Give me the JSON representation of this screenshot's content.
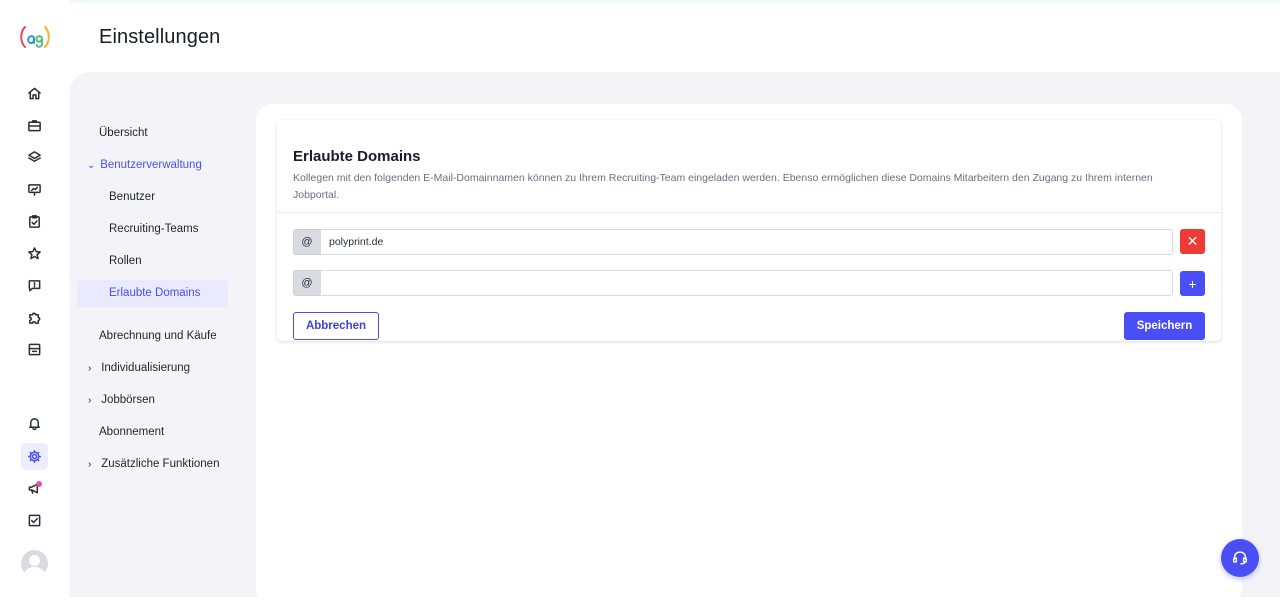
{
  "header": {
    "title": "Einstellungen"
  },
  "rail": {
    "items": [
      {
        "icon": "home-icon"
      },
      {
        "icon": "briefcase-icon"
      },
      {
        "icon": "layers-icon"
      },
      {
        "icon": "presentation-chart-icon"
      },
      {
        "icon": "clipboard-check-icon"
      },
      {
        "icon": "star-icon"
      },
      {
        "icon": "chat-exclamation-icon"
      },
      {
        "icon": "puzzle-icon"
      },
      {
        "icon": "archive-icon"
      }
    ],
    "bottom_items": [
      {
        "icon": "bell-icon"
      },
      {
        "icon": "gear-icon",
        "active": true
      },
      {
        "icon": "megaphone-icon",
        "has_notification": true
      },
      {
        "icon": "checkbox-icon"
      }
    ],
    "accent_color": "#4a4ff5"
  },
  "subnav": {
    "items": [
      {
        "label": "Übersicht"
      },
      {
        "label": "Benutzerverwaltung",
        "expanded": true
      },
      {
        "label": "Benutzer"
      },
      {
        "label": "Recruiting-Teams"
      },
      {
        "label": "Rollen"
      },
      {
        "label": "Erlaubte Domains",
        "selected": true
      },
      {
        "label": "Abrechnung und Käufe"
      },
      {
        "label": "Individualisierung",
        "collapsed": true
      },
      {
        "label": "Jobbörsen",
        "collapsed": true
      },
      {
        "label": "Abonnement"
      },
      {
        "label": "Zusätzliche Funktionen",
        "collapsed": true
      }
    ]
  },
  "card": {
    "title": "Erlaubte Domains",
    "description": "Kollegen mit den folgenden E-Mail-Domainnamen können zu Ihrem Recruiting-Team eingeladen werden. Ebenso ermöglichen diese Domains Mitarbeitern den Zugang zu Ihrem internen Jobportal.",
    "prefix": "@",
    "domains": [
      {
        "value": "polyprint.de",
        "action": "remove",
        "action_symbol": "✕"
      },
      {
        "value": "",
        "action": "add",
        "action_symbol": "+"
      }
    ],
    "cancel_label": "Abbrechen",
    "save_label": "Speichern"
  },
  "colors": {
    "primary": "#4a4ff5",
    "danger": "#ef3b35",
    "background": "#f4f4f8"
  }
}
